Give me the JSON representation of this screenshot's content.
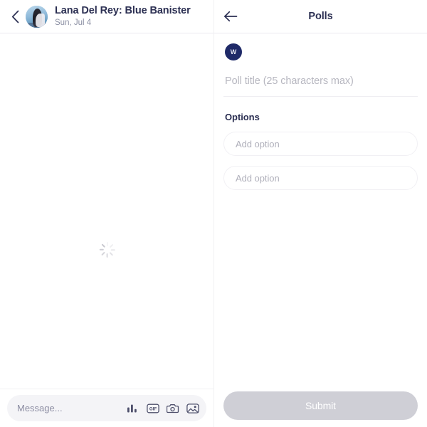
{
  "chat": {
    "back_icon": "chevron-left-icon",
    "avatar_icon": "contact-avatar",
    "title": "Lana Del Rey: Blue Banister",
    "subtitle": "Sun, Jul 4",
    "loading_icon": "loading-spinner",
    "composer": {
      "placeholder": "Message...",
      "value": "",
      "icons": [
        {
          "name": "poll-icon",
          "label": "Poll"
        },
        {
          "name": "gif-icon",
          "label": "GIF"
        },
        {
          "name": "camera-icon",
          "label": "Camera"
        },
        {
          "name": "image-icon",
          "label": "Image"
        }
      ]
    }
  },
  "polls": {
    "back_icon": "arrow-left-icon",
    "title": "Polls",
    "author_avatar_initial": "W",
    "poll_title": {
      "placeholder": "Poll title (25 characters max)",
      "value": ""
    },
    "options_label": "Options",
    "options": [
      {
        "placeholder": "Add option",
        "value": ""
      },
      {
        "placeholder": "Add option",
        "value": ""
      }
    ],
    "submit_label": "Submit"
  },
  "colors": {
    "brand_navy": "#1f2a68",
    "text_primary": "#2b2f52",
    "text_muted": "#8b8fa3",
    "placeholder": "#b0b0bb",
    "field_bg": "#f4f4f7",
    "submit_disabled": "#cfcfd6"
  }
}
